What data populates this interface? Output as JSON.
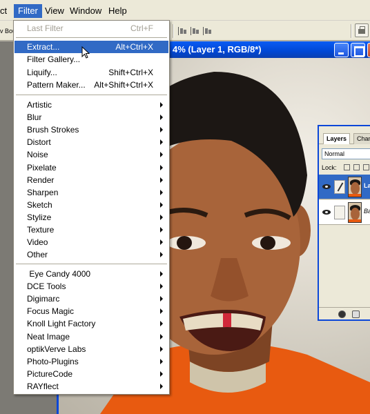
{
  "menubar": {
    "items": [
      {
        "label": "ct"
      },
      {
        "label": "Filter"
      },
      {
        "label": "View"
      },
      {
        "label": "Window"
      },
      {
        "label": "Help"
      }
    ]
  },
  "options_bar": {
    "fragment": "v Bou",
    "palette_icon": "file-browser-icon"
  },
  "document": {
    "title": "4% (Layer 1, RGB/8*)",
    "controls": [
      "minimize-icon",
      "maximize-icon",
      "close-icon"
    ],
    "colors": {
      "titlebar": "#0047d5",
      "shirt": "#e85a10",
      "skin": "#a8643a"
    }
  },
  "layers_panel": {
    "tabs": [
      "Layers",
      "Chan"
    ],
    "blend_mode": "Normal",
    "lock_label": "Lock:",
    "layers": [
      {
        "name": "La",
        "selected": true
      },
      {
        "name": "Ba",
        "selected": false
      }
    ]
  },
  "filter_menu": {
    "top_items": [
      {
        "label": "Last Filter",
        "shortcut": "Ctrl+F",
        "disabled": true
      }
    ],
    "main_items": [
      {
        "label": "Extract...",
        "shortcut": "Alt+Ctrl+X",
        "highlighted": true
      },
      {
        "label": "Filter Gallery...",
        "shortcut": ""
      },
      {
        "label": "Liquify...",
        "shortcut": "Shift+Ctrl+X"
      },
      {
        "label": "Pattern Maker...",
        "shortcut": "Alt+Shift+Ctrl+X"
      }
    ],
    "builtin_groups": [
      "Artistic",
      "Blur",
      "Brush Strokes",
      "Distort",
      "Noise",
      "Pixelate",
      "Render",
      "Sharpen",
      "Sketch",
      "Stylize",
      "Texture",
      "Video",
      "Other"
    ],
    "plugins": [
      " Eye Candy 4000",
      "DCE Tools",
      "Digimarc",
      "Focus Magic",
      "Knoll Light Factory",
      "Neat Image",
      "optikVerve Labs",
      "Photo-Plugins",
      "PictureCode",
      "RAYflect"
    ],
    "highlight_color": "#316ac5"
  }
}
